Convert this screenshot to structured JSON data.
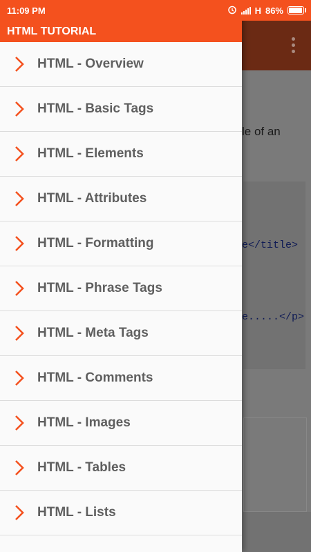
{
  "status_bar": {
    "time": "11:09 PM",
    "network": "H",
    "battery_percent": "86%",
    "battery_level": 0.86
  },
  "drawer": {
    "title": "HTML TUTORIAL",
    "items": [
      {
        "label": "HTML - Overview"
      },
      {
        "label": "HTML - Basic Tags"
      },
      {
        "label": "HTML - Elements"
      },
      {
        "label": "HTML - Attributes"
      },
      {
        "label": "HTML - Formatting"
      },
      {
        "label": "HTML - Phrase Tags"
      },
      {
        "label": "HTML - Meta Tags"
      },
      {
        "label": "HTML - Comments"
      },
      {
        "label": "HTML - Images"
      },
      {
        "label": "HTML - Tables"
      },
      {
        "label": "HTML - Lists"
      }
    ]
  },
  "background_page": {
    "text_fragment": "le of an",
    "code_line_1": "e</title>",
    "code_line_2": "e.....</p>"
  },
  "colors": {
    "accent": "#f4511e",
    "toolbar_dimmed": "#6b2a14",
    "item_text": "#5f5f5f"
  }
}
